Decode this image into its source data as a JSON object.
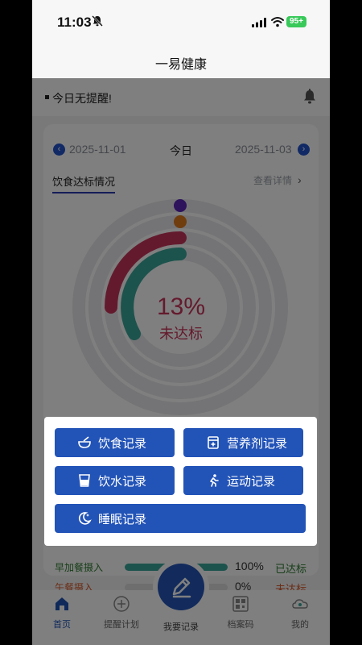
{
  "status_bar": {
    "time": "11:03",
    "battery": "95+"
  },
  "app": {
    "title": "一易健康"
  },
  "reminder": {
    "text": "今日无提醒!"
  },
  "dates": {
    "prev": "2025-11-01",
    "current": "今日",
    "next": "2025-11-03"
  },
  "section": {
    "tab": "饮食达标情况",
    "detail_link": "查看详情"
  },
  "summary": {
    "percent": "13%",
    "status": "未达标"
  },
  "progress_rows": [
    {
      "label": "早加餐摄入",
      "value": "100%",
      "fill": 1.0,
      "status": "已达标"
    },
    {
      "label": "午餐摄入",
      "value": "0%",
      "fill": 0.0,
      "status": "未达标"
    }
  ],
  "record_menu": {
    "diet": "饮食记录",
    "supplement": "营养剂记录",
    "water": "饮水记录",
    "exercise": "运动记录",
    "sleep": "睡眠记录"
  },
  "tabbar": {
    "home": "首页",
    "reminder_plan": "提醒计划",
    "record": "我要记录",
    "archive_code": "档案码",
    "mine": "我的"
  },
  "colors": {
    "accent": "#2253b7",
    "not_met": "#c8355a",
    "met": "#2e7d32"
  }
}
